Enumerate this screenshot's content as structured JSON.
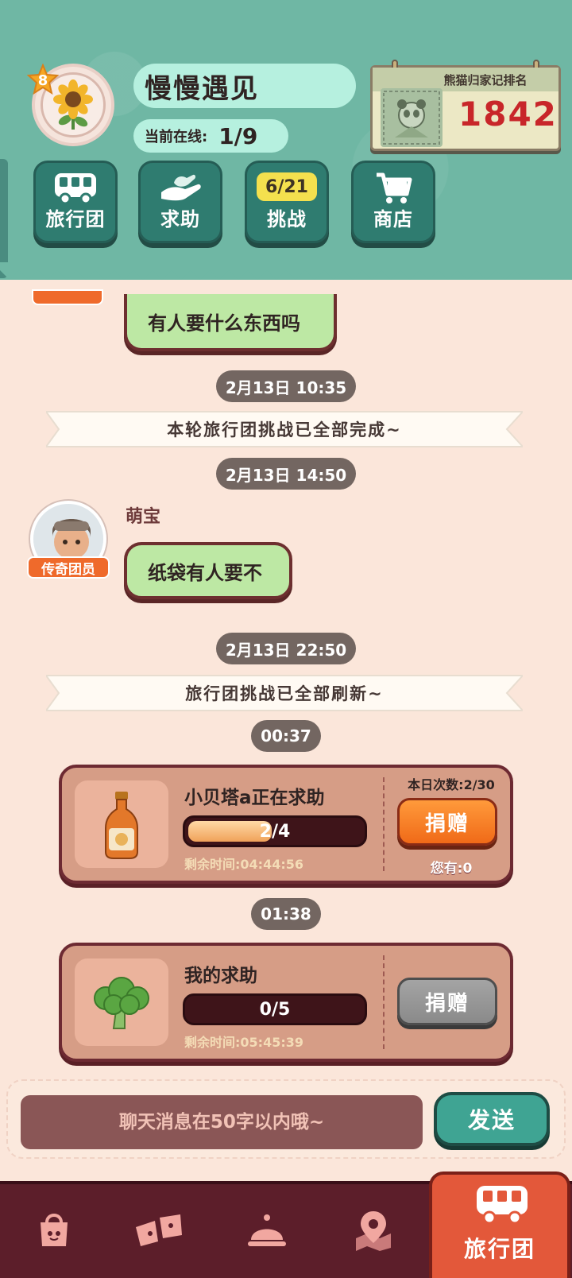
{
  "profile": {
    "level": "8",
    "name": "慢慢遇见",
    "online_label": "当前在线:",
    "online_value": "1/9"
  },
  "rank": {
    "title": "熊猫归家记排名",
    "value": "1842"
  },
  "nav": [
    {
      "label": "旅行团",
      "icon": "bus-icon"
    },
    {
      "label": "求助",
      "icon": "helping-hand-icon"
    },
    {
      "label": "挑战",
      "count": "6/21"
    },
    {
      "label": "商店",
      "icon": "cart-icon"
    }
  ],
  "chat": {
    "prev_bubble": "有人要什么东西吗",
    "time1": "2月13日 10:35",
    "banner1": "本轮旅行团挑战已全部完成~",
    "time2": "2月13日 14:50",
    "member_name": "萌宝",
    "member_badge": "传奇团员",
    "member_message": "纸袋有人要不",
    "time3": "2月13日 22:50",
    "banner2": "旅行团挑战已全部刷新~",
    "time4": "00:37",
    "time5": "01:38"
  },
  "help_requests": [
    {
      "title": "小贝塔a正在求助",
      "item_icon": "sauce-bottle-icon",
      "progress_text": "2/4",
      "progress": 0.5,
      "remaining": "剩余时间:04:44:56",
      "daily_count": "本日次数:2/30",
      "button": "捐赠",
      "owned": "您有:0"
    },
    {
      "title": "我的求助",
      "item_icon": "broccoli-icon",
      "progress_text": "0/5",
      "progress": 0,
      "remaining": "剩余时间:05:45:39",
      "button": "捐赠"
    }
  ],
  "input": {
    "placeholder": "聊天消息在50字以内哦~",
    "send_label": "发送"
  },
  "bottom_nav": {
    "items": [
      "bag-icon",
      "tickets-icon",
      "service-bell-icon",
      "map-pin-icon"
    ],
    "active_label": "旅行团",
    "active_icon": "bus-icon"
  },
  "colors": {
    "header_bg": "#6fb7a4",
    "chat_bg": "#fbe6da",
    "bubble_green": "#bde8a4",
    "donate_orange": "#f06a18",
    "rank_red": "#c8262a",
    "bottom_nav_bg": "#5c1e2a",
    "active_tab": "#e3583a"
  }
}
